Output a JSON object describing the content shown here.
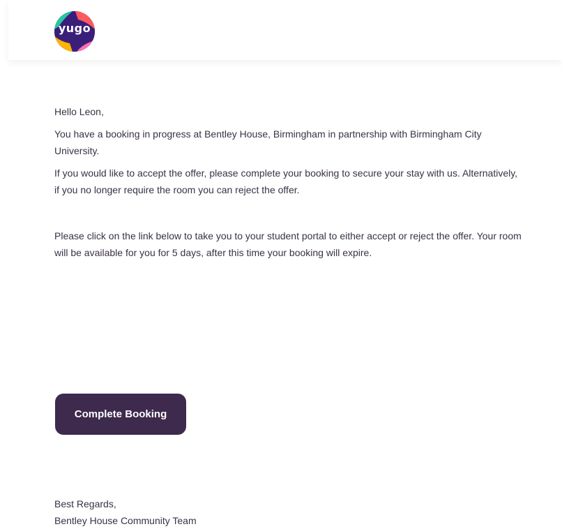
{
  "header": {
    "logo_text": "yugo"
  },
  "email": {
    "greeting": "Hello Leon,",
    "paragraph1": "You have a booking in progress at Bentley House, Birmingham in partnership with Birmingham City University.",
    "paragraph2": "If you would like to accept the offer, please complete your booking to secure your stay with us. Alternatively, if you no longer require the room you can reject the offer.",
    "paragraph3": "Please click on the link below to take you to your student portal to either accept or reject the offer. Your room will be available for you for 5 days, after this time your booking will expire.",
    "cta_label": "Complete Booking",
    "signoff_line1": "Best Regards,",
    "signoff_line2": "Bentley House Community Team"
  },
  "colors": {
    "button_bg": "#3d2a4d",
    "text": "#3a3145",
    "logo_bg": "#3a1f7a"
  }
}
